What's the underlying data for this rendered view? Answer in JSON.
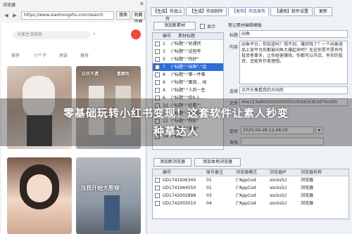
{
  "browser": {
    "title": "浏览器",
    "url": "https://www.xiaohongshu.com/search",
    "search_button": "搜索",
    "favorite_button": "收藏页面",
    "site_search_placeholder": "大家生活指南",
    "categories": [
      "推荐",
      "小个子",
      "男装",
      "健身"
    ],
    "cards": [
      {
        "caption": ""
      },
      {
        "caption": "白衣不透"
      },
      {
        "caption": "看颜色"
      },
      {
        "caption": "当我开始大胆穿"
      }
    ]
  },
  "app": {
    "tabs": [
      {
        "label": "【生成】作品上传"
      },
      {
        "label": "【生成】作品制作"
      },
      {
        "label": "【发布】作品发布",
        "active": true
      },
      {
        "label": "【通用】软件设置"
      },
      {
        "label": "更新"
      }
    ],
    "add_material_button": "添加新素材",
    "show_label": "显示",
    "edit_title_label": "笔记素材编辑模板",
    "material_table": {
      "headers": [
        "编号",
        "素材标题"
      ],
      "rows": [
        {
          "no": "1",
          "title": "(\"标题\":\"初遇伏"
        },
        {
          "no": "3",
          "title": "(\"标题\":\"这些年"
        },
        {
          "no": "5",
          "title": "(\"标题\":\"你好\""
        },
        {
          "no": "7",
          "title": "(\"标题\":\"闲鱼\",\"话",
          "selected": true
        },
        {
          "no": "8",
          "title": "(\"标题\":\"第一件事"
        },
        {
          "no": "9",
          "title": "(\"标题\":\"跟我... 闲"
        },
        {
          "no": "4",
          "title": "(\"标题\":\"人的一生"
        },
        {
          "no": "6",
          "title": "(\"标题\":\"你0-1..."
        },
        {
          "no": "10",
          "title": "(\"标题\":\"好看\"\""
        },
        {
          "no": "11",
          "title": "(\"标题\":\"我就是"
        },
        {
          "no": "12",
          "title": "(\"标题\":\"你好\""
        },
        {
          "no": "13",
          "title": "(\"标题\":\"美食\""
        },
        {
          "no": "14",
          "title": "(\"标题\":\"...\""
        }
      ]
    },
    "form": {
      "title_label": "标题",
      "title_value": "闲鱼",
      "content_label": "内容",
      "content_value": "闲鱼平台，你知道吗？想不到，赚到钱了？一个闲鱼商品上架平台后都被闲鱼大爆起来呵？无论你是不是有所投资者事多，让你经营赚钱，你都可以开店，有你的投资，还能有作者理想。",
      "select_label": "选择",
      "select_value": "点开头像看我的大闲后",
      "file_label": "文件",
      "file_value": "60e123e8000000000001003dc63b3d70c000",
      "time_label": "定时",
      "time_value": "2025-04-28 12:48:29",
      "publish_label": "发布"
    },
    "add_browser_button": "添加新浏览器",
    "add_local_button": "添加本地浏览器",
    "account_table": {
      "headers": [
        "编号",
        "账号备注",
        "浏览器模式",
        "浏览器IP",
        "浏览器名称"
      ],
      "rows": [
        {
          "no": "UD1741936340",
          "remark": "01",
          "mode": "(\"AppCod",
          "ip": "socks5//",
          "name": "浏览器"
        },
        {
          "no": "UD1741944550",
          "remark": "01",
          "mode": "(\"AppCod",
          "ip": "socks5//",
          "name": "浏览器"
        },
        {
          "no": "UD1742002898",
          "remark": "03",
          "mode": "(\"AppCod",
          "ip": "socks5//",
          "name": "浏览器"
        },
        {
          "no": "UD1742003010",
          "remark": "04",
          "mode": "(\"AppCod",
          "ip": "socks5//",
          "name": "浏览器"
        }
      ]
    }
  },
  "overlay": {
    "line1": "零基础玩转小红书变现！这套软件让素人秒变",
    "line2": "种草达人"
  }
}
